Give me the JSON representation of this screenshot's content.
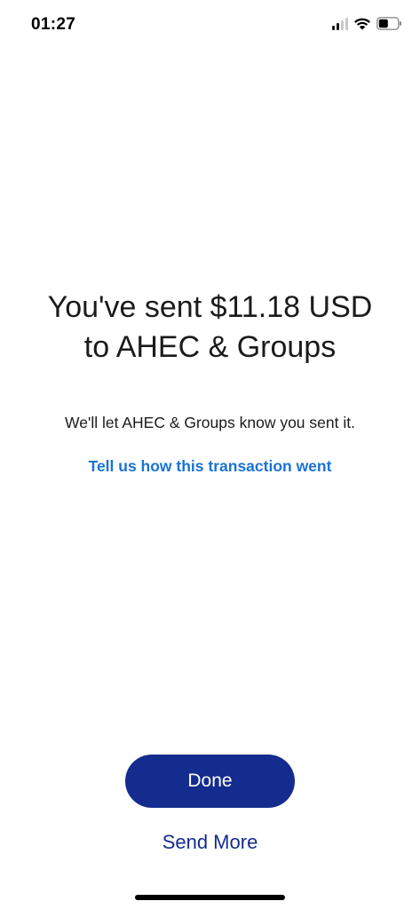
{
  "status_bar": {
    "time": "01:27",
    "icons": [
      "signal-icon",
      "wifi-icon",
      "battery-icon"
    ],
    "battery_level": 0.5
  },
  "confirmation": {
    "headline_line1": "You've sent $11.18 USD",
    "headline_line2": "to AHEC & Groups",
    "subtext": "We'll let AHEC & Groups know you sent it.",
    "feedback_link": "Tell us how this transaction went"
  },
  "actions": {
    "done_label": "Done",
    "send_more_label": "Send More"
  },
  "colors": {
    "primary_button": "#142c8e",
    "link": "#1a73d6",
    "text": "#1b1b1b"
  }
}
